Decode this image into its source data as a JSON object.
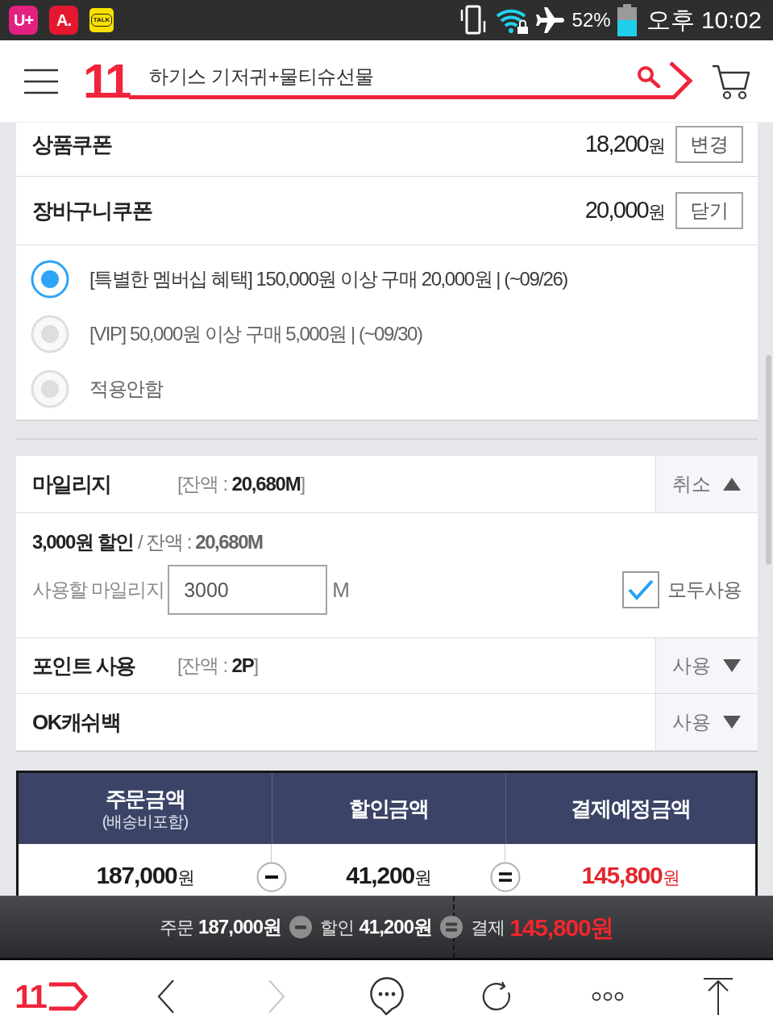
{
  "status_bar": {
    "notifications": [
      {
        "text": "U+",
        "kind": "tile",
        "color": "#e2207f"
      },
      {
        "text": "A.",
        "kind": "tile",
        "color": "#e5172f"
      },
      {
        "text": "TALK",
        "kind": "bubble",
        "color": "#f9e000"
      }
    ],
    "battery_text": "52%",
    "time": "오후 10:02"
  },
  "header": {
    "logo": "11",
    "search_query": "하기스 기저귀+물티슈선물"
  },
  "coupons": [
    {
      "label": "상품쿠폰",
      "amount": "18,200",
      "unit": "원",
      "button": "변경"
    },
    {
      "label": "장바구니쿠폰",
      "amount": "20,000",
      "unit": "원",
      "button": "닫기"
    }
  ],
  "coupon_options": [
    {
      "text": "[특별한 멤버십 혜택] 150,000원 이상 구매 20,000원 | (~09/26)",
      "selected": true
    },
    {
      "text": "[VIP] 50,000원 이상 구매 5,000원 | (~09/30)",
      "selected": false
    },
    {
      "text": "적용안함",
      "selected": false
    }
  ],
  "benefits": [
    {
      "label": "마일리지",
      "balance": "[잔액 : **20,680M**]",
      "toggle": "취소",
      "expanded": true,
      "discount": "3,000원 할인",
      "detail": "/ 잔액 : **20,680M**",
      "field_label": "사용할 마일리지",
      "value": "3000",
      "unit": "M",
      "use_all": {
        "label": "모두사용",
        "checked": true
      }
    },
    {
      "label": "포인트 사용",
      "balance": "[잔액 : **2P**]",
      "toggle": "사용",
      "expanded": false
    },
    {
      "label": "OK캐쉬백",
      "toggle": "사용",
      "expanded": false
    }
  ],
  "summary_table": {
    "columns": [
      {
        "title": "주문금액",
        "note": "(배송비포함)",
        "amount": "187,000",
        "unit": "원",
        "highlight": false
      },
      {
        "title": "할인금액",
        "amount": "41,200",
        "unit": "원",
        "highlight": false
      },
      {
        "title": "결제예정금액",
        "amount": "145,800",
        "unit": "원",
        "highlight": true
      }
    ],
    "operators": [
      {
        "kind": "minus"
      },
      {
        "kind": "equals"
      }
    ]
  },
  "summary_bar": {
    "items": [
      {
        "kind": "amount",
        "label": "주문",
        "amount": "187,000원",
        "highlight": false
      },
      {
        "kind": "minus"
      },
      {
        "kind": "amount",
        "label": "할인",
        "amount": "41,200원",
        "highlight": false
      },
      {
        "kind": "equals"
      },
      {
        "kind": "amount",
        "label": "결제",
        "amount": "145,800원",
        "highlight": true
      }
    ]
  },
  "bottom_nav": {
    "logo": "11",
    "buttons": [
      {
        "kind": "back",
        "disabled": false
      },
      {
        "kind": "forward",
        "disabled": true
      },
      {
        "kind": "chat",
        "disabled": false
      },
      {
        "kind": "refresh",
        "disabled": false
      },
      {
        "kind": "more",
        "disabled": false
      },
      {
        "kind": "top",
        "disabled": false
      }
    ]
  }
}
